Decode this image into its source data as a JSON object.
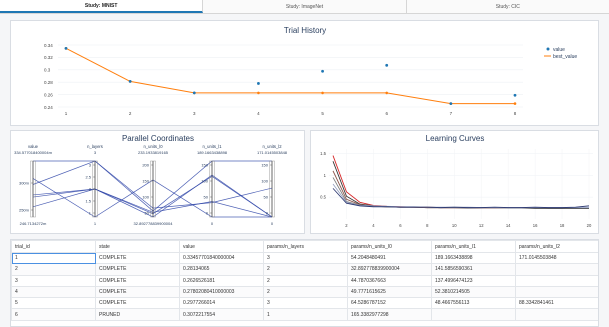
{
  "tabs": [
    {
      "label": "Study: MNIST",
      "active": true
    },
    {
      "label": "Study: ImageNet",
      "active": false
    },
    {
      "label": "Study: CIC",
      "active": false
    }
  ],
  "trial_history": {
    "title": "Trial History",
    "legend": [
      "value",
      "best_value"
    ],
    "colors": {
      "value": "#1f77b4",
      "best_value": "#ff7f0e"
    },
    "chart_data": {
      "type": "line",
      "x": [
        1,
        2,
        3,
        4,
        5,
        6,
        7,
        8
      ],
      "series": [
        {
          "name": "value",
          "mode": "markers",
          "values": [
            0.3346,
            0.2813,
            0.2627,
            0.278,
            0.2977,
            0.3072,
            0.2455,
            0.259
          ]
        },
        {
          "name": "best_value",
          "mode": "line",
          "values": [
            0.3346,
            0.2813,
            0.2627,
            0.2627,
            0.2627,
            0.2627,
            0.2455,
            0.2455
          ]
        }
      ],
      "yticks": [
        "0.24",
        "0.26",
        "0.28",
        "0.3",
        "0.32",
        "0.34"
      ],
      "ylim": [
        0.24,
        0.34
      ],
      "xticks": [
        "1",
        "2",
        "3",
        "4",
        "5",
        "6",
        "7",
        "8"
      ]
    }
  },
  "parallel": {
    "title": "Parallel Coordinates",
    "axes": [
      {
        "name": "value",
        "top": "334.577018400004m",
        "bottom": "246.7134272m",
        "ticks": [
          "300m",
          "250m"
        ]
      },
      {
        "name": "n_layers",
        "top": "3",
        "bottom": "1",
        "ticks": [
          "3",
          "2.5",
          "2",
          "1.5",
          "1"
        ]
      },
      {
        "name": "n_units_l0",
        "top": "233.1933819165",
        "bottom": "32.892778839900004",
        "ticks": [
          "200",
          "150",
          "100",
          "50"
        ]
      },
      {
        "name": "n_units_l1",
        "top": "189.1663438898",
        "bottom": "0",
        "ticks": [
          "150",
          "100",
          "50",
          "0"
        ]
      },
      {
        "name": "n_units_l2",
        "top": "171.0145503848",
        "bottom": "0",
        "ticks": [
          "150",
          "100",
          "50",
          "0"
        ]
      }
    ]
  },
  "curves": {
    "title": "Learning Curves",
    "chart_data": {
      "type": "line",
      "xticks": [
        "2",
        "4",
        "6",
        "8",
        "10",
        "12",
        "14",
        "16",
        "18",
        "20"
      ],
      "yticks": [
        "1.5",
        "1",
        "0.5"
      ],
      "series": [
        {
          "color": "#d62728",
          "values": [
            1.45,
            0.62,
            0.38,
            0.31,
            0.29,
            0.28,
            0.27,
            0.27,
            0.26,
            0.26,
            0.26,
            0.25,
            0.25,
            0.25,
            0.25,
            0.25,
            0.25,
            0.24,
            0.24,
            0.24
          ]
        },
        {
          "color": "#333333",
          "values": [
            1.32,
            0.52,
            0.34,
            0.3,
            0.28,
            0.27,
            0.27,
            0.26,
            0.26,
            0.26,
            0.25,
            0.25,
            0.25,
            0.25,
            0.25,
            0.24,
            0.24,
            0.24,
            0.24,
            0.24
          ]
        },
        {
          "color": "#8c564b",
          "values": [
            1.1,
            0.45,
            0.33,
            0.29,
            0.28,
            0.27,
            0.27,
            0.26,
            0.26,
            0.26,
            0.26,
            0.25,
            0.25,
            0.25,
            0.25,
            0.25,
            0.25,
            0.25,
            0.25,
            0.25
          ]
        },
        {
          "color": "#7f7f7f",
          "values": [
            0.95,
            0.4,
            0.32,
            0.29,
            0.28,
            0.27,
            0.27,
            0.27,
            0.26,
            0.26,
            0.26,
            0.26,
            0.26,
            0.25,
            0.25,
            0.25,
            0.25,
            0.25,
            0.25,
            0.25
          ]
        },
        {
          "color": "#9aa5c4",
          "values": [
            0.8,
            0.38,
            0.31,
            0.3,
            0.29,
            0.28,
            0.28,
            0.27,
            0.27,
            0.27,
            0.27,
            0.26,
            0.26,
            0.26,
            0.26,
            0.26,
            0.26,
            0.26,
            0.26,
            0.26
          ]
        },
        {
          "color": "#2f3b73",
          "values": [
            0.7,
            0.36,
            0.3,
            0.28,
            0.28,
            0.27,
            0.27,
            0.27,
            0.26,
            0.27,
            0.26,
            0.26,
            0.27,
            0.26,
            0.26,
            0.27,
            0.26,
            0.26,
            0.27,
            0.3
          ]
        }
      ]
    }
  },
  "table": {
    "columns": [
      "trial_id",
      "state",
      "value",
      "params/n_layers",
      "params/n_units_l0",
      "params/n_units_l1",
      "params/n_units_l2"
    ],
    "rows": [
      [
        "1",
        "COMPLETE",
        "0.33457701840000004",
        "3",
        "54.2048480491",
        "189.1663438898",
        "171.014550384​8"
      ],
      [
        "2",
        "COMPLETE",
        "0.28134065",
        "2",
        "32.892778839900004",
        "141.5856590361",
        ""
      ],
      [
        "3",
        "COMPLETE",
        "0.2626526181",
        "2",
        "44.7870367663",
        "137.4996474123",
        ""
      ],
      [
        "4",
        "COMPLETE",
        "0.27802080410000003",
        "2",
        "49.7771615625",
        "52.3810214505",
        ""
      ],
      [
        "5",
        "COMPLETE",
        "0.2977266014",
        "3",
        "64.5286787152",
        "48.4667556113",
        "88.3342841461"
      ],
      [
        "6",
        "PRUNED",
        "0.3072217554",
        "1",
        "165.3382977298",
        "",
        ""
      ]
    ]
  }
}
